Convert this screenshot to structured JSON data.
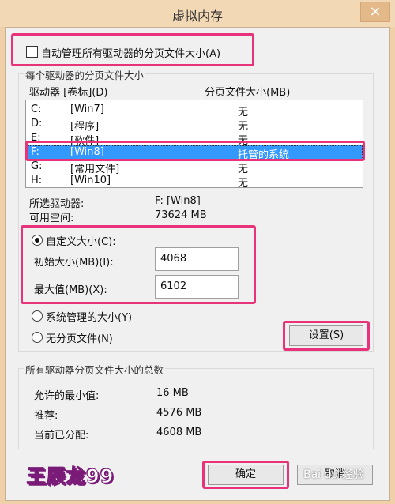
{
  "window": {
    "title": "虚拟内存",
    "close_glyph": "×"
  },
  "auto_manage": {
    "label": "自动管理所有驱动器的分页文件大小(A)",
    "checked": false
  },
  "per_drive_group": {
    "label": "每个驱动器的分页文件大小"
  },
  "list": {
    "col_drive": "驱动器 [卷标](D)",
    "col_size": "分页文件大小(MB)",
    "rows": [
      {
        "drive": "C:",
        "volume": "[Win7]",
        "size": "无"
      },
      {
        "drive": "D:",
        "volume": "[程序]",
        "size": "无"
      },
      {
        "drive": "E:",
        "volume": "[软件]",
        "size": "无"
      },
      {
        "drive": "F:",
        "volume": "[Win8]",
        "size": "托管的系统"
      },
      {
        "drive": "G:",
        "volume": "[常用文件]",
        "size": "无"
      },
      {
        "drive": "H:",
        "volume": "[Win10]",
        "size": "无"
      }
    ]
  },
  "selected": {
    "drive_label": "所选驱动器:",
    "drive_value": "F:  [Win8]",
    "space_label": "可用空间:",
    "space_value": "73624 MB"
  },
  "custom_size": {
    "label": "自定义大小(C):",
    "initial_label": "初始大小(MB)(I):",
    "initial_value": "4068",
    "max_label": "最大值(MB)(X):",
    "max_value": "6102"
  },
  "system_managed": {
    "label": "系统管理的大小(Y)"
  },
  "no_paging": {
    "label": "无分页文件(N)"
  },
  "set_button": "设置(S)",
  "total_group": {
    "label": "所有驱动器分页文件大小的总数",
    "min_label": "允许的最小值:",
    "min_value": "16 MB",
    "rec_label": "推荐:",
    "rec_value": "4576 MB",
    "cur_label": "当前已分配:",
    "cur_value": "4608 MB"
  },
  "ok_button": "确定",
  "cancel_button": "取消",
  "watermark": "王辰龙99",
  "site_watermark": "Bai du 经验",
  "colors": {
    "highlight": "#e8337a",
    "selection": "#3399ff",
    "frame": "#f0d0a8"
  }
}
